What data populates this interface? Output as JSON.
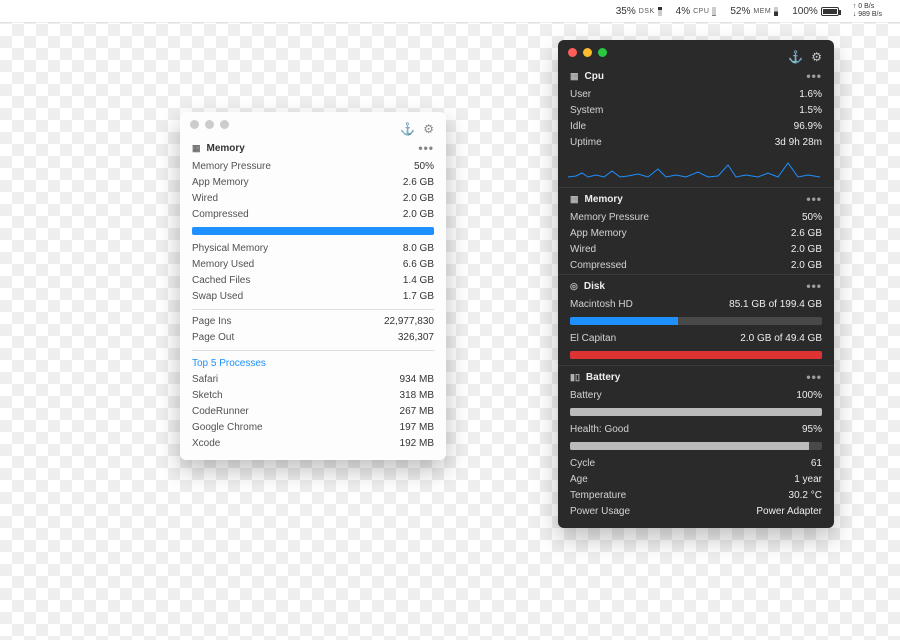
{
  "menubar": {
    "disk": {
      "value": "35%",
      "label": "DSK"
    },
    "cpu": {
      "value": "4%",
      "label": "CPU"
    },
    "mem": {
      "value": "52%",
      "label": "MEM"
    },
    "battery": {
      "value": "100%"
    },
    "net": {
      "up": "↑ 0 B/s",
      "down": "↓ 989 B/s"
    }
  },
  "light": {
    "title": "Memory",
    "block1": [
      {
        "k": "Memory Pressure",
        "v": "50%"
      },
      {
        "k": "App Memory",
        "v": "2.6 GB"
      },
      {
        "k": "Wired",
        "v": "2.0 GB"
      },
      {
        "k": "Compressed",
        "v": "2.0 GB"
      }
    ],
    "block2": [
      {
        "k": "Physical Memory",
        "v": "8.0 GB"
      },
      {
        "k": "Memory Used",
        "v": "6.6 GB"
      },
      {
        "k": "Cached Files",
        "v": "1.4 GB"
      },
      {
        "k": "Swap Used",
        "v": "1.7 GB"
      }
    ],
    "block3": [
      {
        "k": "Page Ins",
        "v": "22,977,830"
      },
      {
        "k": "Page Out",
        "v": "326,307"
      }
    ],
    "procs_title": "Top 5 Processes",
    "procs": [
      {
        "k": "Safari",
        "v": "934 MB"
      },
      {
        "k": "Sketch",
        "v": "318 MB"
      },
      {
        "k": "CodeRunner",
        "v": "267 MB"
      },
      {
        "k": "Google Chrome",
        "v": "197 MB"
      },
      {
        "k": "Xcode",
        "v": "192 MB"
      }
    ]
  },
  "dark": {
    "cpu": {
      "title": "Cpu",
      "rows": [
        {
          "k": "User",
          "v": "1.6%"
        },
        {
          "k": "System",
          "v": "1.5%"
        },
        {
          "k": "Idle",
          "v": "96.9%"
        },
        {
          "k": "Uptime",
          "v": "3d 9h 28m"
        }
      ]
    },
    "memory": {
      "title": "Memory",
      "rows": [
        {
          "k": "Memory Pressure",
          "v": "50%"
        },
        {
          "k": "App Memory",
          "v": "2.6 GB"
        },
        {
          "k": "Wired",
          "v": "2.0 GB"
        },
        {
          "k": "Compressed",
          "v": "2.0 GB"
        }
      ]
    },
    "disk": {
      "title": "Disk",
      "vol1": {
        "name": "Macintosh HD",
        "stat": "85.1 GB of 199.4 GB"
      },
      "vol2": {
        "name": "El Capitan",
        "stat": "2.0 GB of 49.4 GB"
      }
    },
    "battery": {
      "title": "Battery",
      "row1": {
        "k": "Battery",
        "v": "100%"
      },
      "row2": {
        "k": "Health: Good",
        "v": "95%"
      },
      "stats": [
        {
          "k": "Cycle",
          "v": "61"
        },
        {
          "k": "Age",
          "v": "1 year"
        },
        {
          "k": "Temperature",
          "v": "30.2 °C"
        },
        {
          "k": "Power Usage",
          "v": "Power Adapter"
        }
      ]
    }
  }
}
